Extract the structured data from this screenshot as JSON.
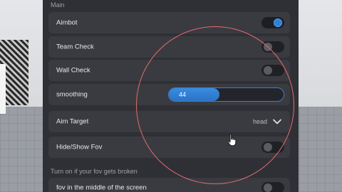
{
  "panel": {
    "section_title": "Main",
    "note": "Turn on if your fov gets broken"
  },
  "rows": [
    {
      "label": "Aimbot",
      "type": "toggle",
      "enabled": true
    },
    {
      "label": "Team Check",
      "type": "toggle",
      "enabled": false
    },
    {
      "label": "Wall Check",
      "type": "toggle",
      "enabled": false
    },
    {
      "label": "smoothing",
      "type": "slider",
      "value": "44",
      "fill_fraction": 0.44
    },
    {
      "label": "Aim Target",
      "type": "dropdown",
      "value": "head"
    },
    {
      "label": "Hide/Show Fov",
      "type": "toggle",
      "enabled": false
    },
    {
      "label": "fov in the middle of the screen",
      "type": "toggle",
      "enabled": false
    }
  ],
  "icons": {
    "dropdown": "chevron-down-icon",
    "cursor": "hand-pointer-icon"
  },
  "colors": {
    "panel": "#2f3035",
    "row": "#3a3b41",
    "accent": "#2f82d6",
    "fov_circle": "#e46a6a"
  }
}
